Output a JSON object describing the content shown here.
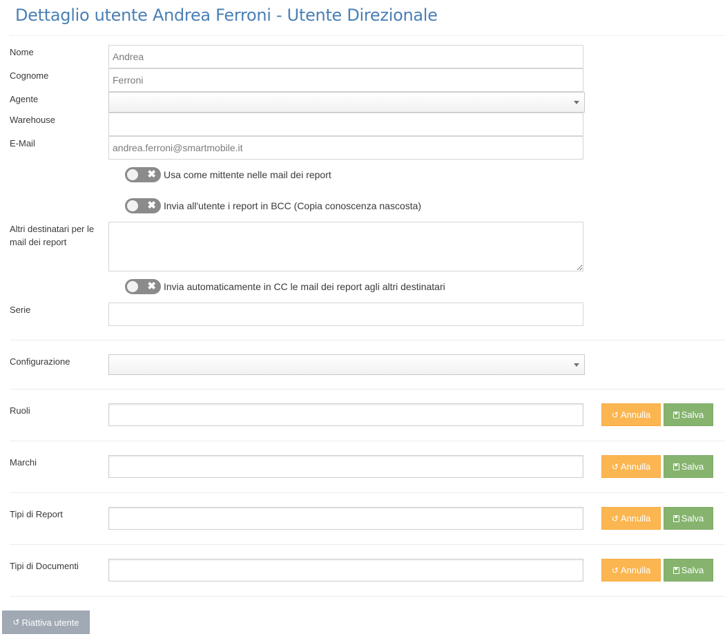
{
  "page": {
    "title": "Dettaglio utente Andrea Ferroni - Utente Direzionale"
  },
  "form": {
    "nome": {
      "label": "Nome",
      "value": "Andrea"
    },
    "cognome": {
      "label": "Cognome",
      "value": "Ferroni"
    },
    "agente": {
      "label": "Agente",
      "value": ""
    },
    "warehouse": {
      "label": "Warehouse",
      "value": ""
    },
    "email": {
      "label": "E-Mail",
      "value": "andrea.ferroni@smartmobile.it"
    },
    "toggles": {
      "mittente": {
        "label": "Usa come mittente nelle mail dei report",
        "on": false
      },
      "bcc": {
        "label": "Invia all'utente i report in BCC (Copia conoscenza nascosta)",
        "on": false
      },
      "cc_auto": {
        "label": "Invia automaticamente in CC le mail dei report agli altri destinatari",
        "on": false
      }
    },
    "altri_destinatari": {
      "label": "Altri destinatari per le mail dei report",
      "value": ""
    },
    "serie": {
      "label": "Serie",
      "value": ""
    },
    "configurazione": {
      "label": "Configurazione",
      "value": ""
    },
    "ruoli": {
      "label": "Ruoli",
      "value": ""
    },
    "marchi": {
      "label": "Marchi",
      "value": ""
    },
    "tipi_report": {
      "label": "Tipi di Report",
      "value": ""
    },
    "tipi_documenti": {
      "label": "Tipi di Documenti",
      "value": ""
    }
  },
  "buttons": {
    "annulla": "Annulla",
    "salva": "Salva",
    "riattiva": "Riattiva utente"
  },
  "icons": {
    "toggle_off": "close-icon",
    "annulla": "undo-icon",
    "salva": "floppy-disk-icon",
    "riattiva": "undo-icon"
  },
  "colors": {
    "title": "#4a80b5",
    "annulla": "#fbb651",
    "salva": "#86b46e",
    "riattiva": "#a0a9b4",
    "toggle_off": "#8b8b8b"
  }
}
